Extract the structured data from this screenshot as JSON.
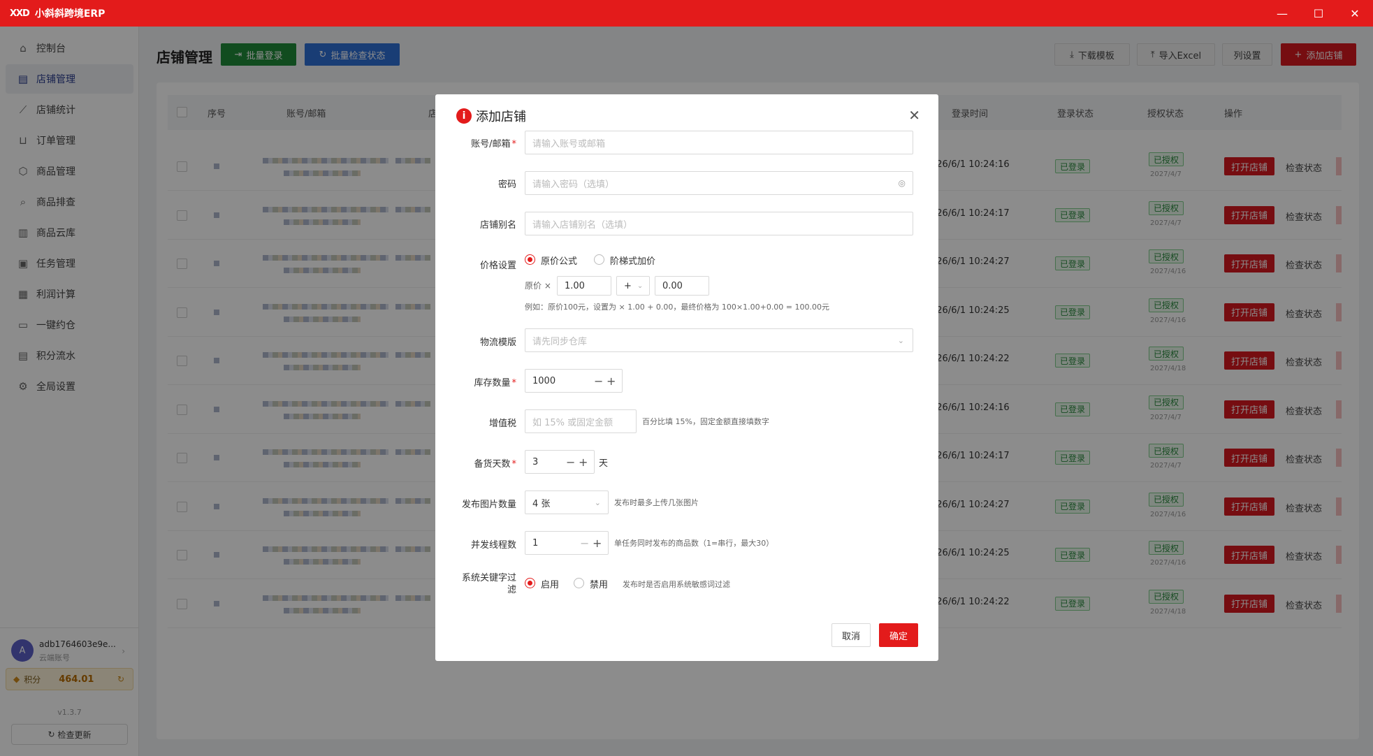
{
  "app": {
    "logo": "XXD",
    "title": "小斜斜跨境ERP"
  },
  "window": {
    "minimize": "—",
    "maximize": "☐",
    "close": "✕"
  },
  "sidebar": {
    "items": [
      {
        "label": "控制台",
        "icon": "home-icon"
      },
      {
        "label": "店铺管理",
        "icon": "store-icon"
      },
      {
        "label": "店铺统计",
        "icon": "chart-line-icon"
      },
      {
        "label": "订单管理",
        "icon": "cart-icon"
      },
      {
        "label": "商品管理",
        "icon": "cube-icon"
      },
      {
        "label": "商品排查",
        "icon": "search-icon"
      },
      {
        "label": "商品云库",
        "icon": "warehouse-icon"
      },
      {
        "label": "任务管理",
        "icon": "clipboard-icon"
      },
      {
        "label": "利润计算",
        "icon": "calculator-icon"
      },
      {
        "label": "一键约仓",
        "icon": "calendar-icon"
      },
      {
        "label": "积分流水",
        "icon": "ledger-icon"
      },
      {
        "label": "全局设置",
        "icon": "gear-icon"
      }
    ],
    "active_index": 1,
    "user": {
      "avatar": "A",
      "name": "adb1764603e9e...",
      "sub": "云端账号"
    },
    "points": {
      "label": "积分",
      "value": "464.01"
    },
    "version": "v1.3.7",
    "check_update": "检查更新"
  },
  "page": {
    "title": "店铺管理"
  },
  "toolbar": {
    "batch_login": "批量登录",
    "batch_check": "批量检查状态",
    "download_template": "下载模板",
    "import_excel": "导入Excel",
    "column_settings": "列设置",
    "add_store": "添加店铺"
  },
  "table": {
    "headers": {
      "index": "序号",
      "account": "账号/邮箱",
      "store": "店",
      "login_time": "登录时间",
      "login_status": "登录状态",
      "auth_status": "授权状态",
      "actions": "操作"
    },
    "rows": [
      {
        "login_time": "026/6/1 10:24:16",
        "login_status": "已登录",
        "auth_status": "已授权",
        "auth_date": "2027/4/7"
      },
      {
        "login_time": "026/6/1 10:24:17",
        "login_status": "已登录",
        "auth_status": "已授权",
        "auth_date": "2027/4/7"
      },
      {
        "login_time": "026/6/1 10:24:27",
        "login_status": "已登录",
        "auth_status": "已授权",
        "auth_date": "2027/4/16"
      },
      {
        "login_time": "026/6/1 10:24:25",
        "login_status": "已登录",
        "auth_status": "已授权",
        "auth_date": "2027/4/16"
      },
      {
        "login_time": "026/6/1 10:24:22",
        "login_status": "已登录",
        "auth_status": "已授权",
        "auth_date": "2027/4/18"
      },
      {
        "login_time": "026/6/1 10:24:16",
        "login_status": "已登录",
        "auth_status": "已授权",
        "auth_date": "2027/4/7"
      },
      {
        "login_time": "026/6/1 10:24:17",
        "login_status": "已登录",
        "auth_status": "已授权",
        "auth_date": "2027/4/7"
      },
      {
        "login_time": "026/6/1 10:24:27",
        "login_status": "已登录",
        "auth_status": "已授权",
        "auth_date": "2027/4/16"
      },
      {
        "login_time": "026/6/1 10:24:25",
        "login_status": "已登录",
        "auth_status": "已授权",
        "auth_date": "2027/4/16"
      },
      {
        "login_time": "026/6/1 10:24:22",
        "login_status": "已登录",
        "auth_status": "已授权",
        "auth_date": "2027/4/18"
      }
    ],
    "open_store": "打开店铺",
    "check_status": "检查状态"
  },
  "modal": {
    "title": "添加店铺",
    "fields": {
      "account": {
        "label": "账号/邮箱",
        "placeholder": "请输入账号或邮箱"
      },
      "password": {
        "label": "密码",
        "placeholder": "请输入密码（选填）"
      },
      "alias": {
        "label": "店铺别名",
        "placeholder": "请输入店铺别名（选填）"
      },
      "price": {
        "label": "价格设置",
        "option_formula": "原价公式",
        "option_tier": "阶梯式加价",
        "prefix": "原价 ×",
        "multiplier": "1.00",
        "operator": "+",
        "addend": "0.00",
        "example": "例如：原价100元，设置为 × 1.00 + 0.00，最终价格为 100×1.00+0.00 = 100.00元"
      },
      "logistics": {
        "label": "物流模版",
        "placeholder": "请先同步仓库"
      },
      "stock": {
        "label": "库存数量",
        "value": "1000"
      },
      "vat": {
        "label": "增值税",
        "placeholder": "如 15% 或固定金额",
        "hint": "百分比填 15%，固定金额直接填数字"
      },
      "stock_days": {
        "label": "备货天数",
        "value": "3",
        "unit": "天"
      },
      "image_count": {
        "label": "发布图片数量",
        "value": "4 张",
        "hint": "发布时最多上传几张图片"
      },
      "threads": {
        "label": "并发线程数",
        "value": "1",
        "hint": "单任务同时发布的商品数（1=串行，最大30）"
      },
      "keyword_filter": {
        "label_line1": "系统关键字过",
        "label_line2": "滤",
        "on": "启用",
        "off": "禁用",
        "hint": "发布时是否启用系统敏感词过滤"
      }
    },
    "cancel": "取消",
    "confirm": "确定"
  }
}
